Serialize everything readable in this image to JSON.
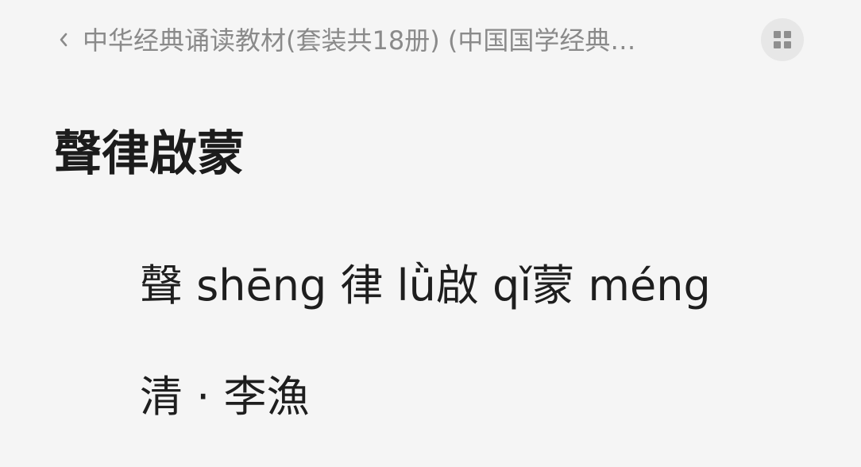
{
  "header": {
    "book_title": "中华经典诵读教材(套装共18册) (中国国学经典…",
    "back_icon": "chevron-left-icon",
    "menu_icon": "grid-icon"
  },
  "content": {
    "chapter_title": "聲律啟蒙",
    "pinyin_line": "聲 shēng 律 lǜ啟 qǐ蒙 méng",
    "author_line": "清 · 李漁"
  }
}
